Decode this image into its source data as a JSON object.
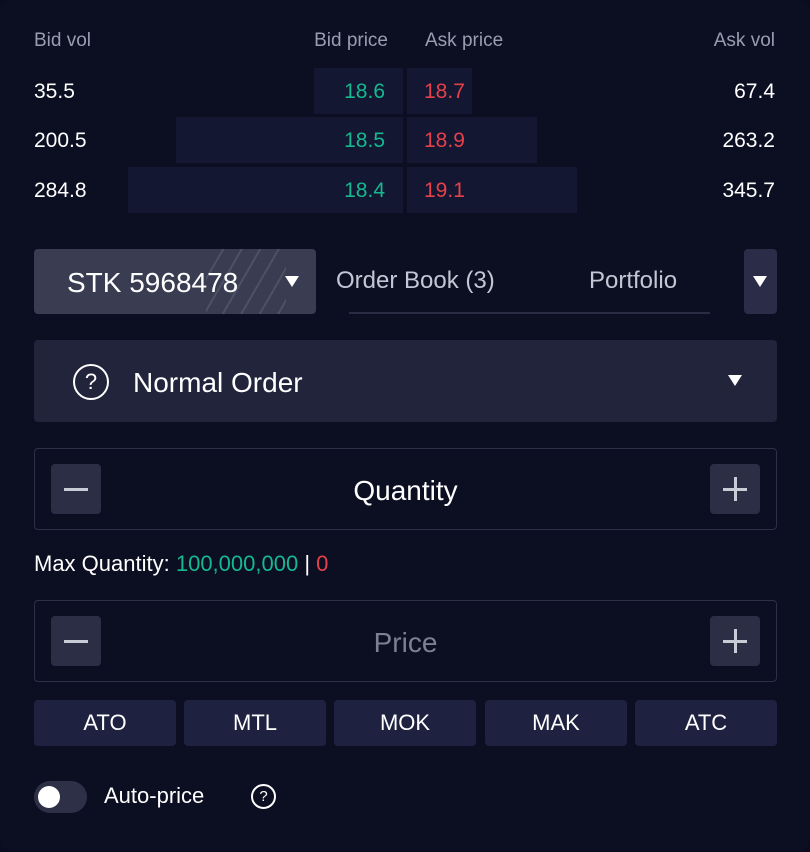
{
  "order_book": {
    "headers": {
      "bid_vol": "Bid vol",
      "bid_price": "Bid price",
      "ask_price": "Ask price",
      "ask_vol": "Ask vol"
    },
    "rows": [
      {
        "bid_vol": "35.5",
        "bid_price": "18.6",
        "ask_price": "18.7",
        "ask_vol": "67.4",
        "bid_depth": 0.11,
        "ask_depth": 0.08
      },
      {
        "bid_vol": "200.5",
        "bid_price": "18.5",
        "ask_price": "18.9",
        "ask_vol": "263.2",
        "bid_depth": 0.28,
        "ask_depth": 0.16
      },
      {
        "bid_vol": "284.8",
        "bid_price": "18.4",
        "ask_price": "19.1",
        "ask_vol": "345.7",
        "bid_depth": 0.34,
        "ask_depth": 0.21
      }
    ]
  },
  "symbol": {
    "label": "STK 5968478",
    "icon": "chevron-down-icon"
  },
  "tabs": [
    {
      "label": "Order Book (3)"
    },
    {
      "label": "Portfolio"
    }
  ],
  "order_type": {
    "label": "Normal Order",
    "help_icon": "?"
  },
  "quantity": {
    "placeholder": "Quantity",
    "minus_icon": "minus-icon",
    "plus_icon": "plus-icon"
  },
  "max_quantity": {
    "label": "Max Quantity:",
    "value": "100,000,000",
    "separator": "|",
    "value2": "0"
  },
  "price": {
    "placeholder": "Price",
    "minus_icon": "minus-icon",
    "plus_icon": "plus-icon"
  },
  "price_types": [
    "ATO",
    "MTL",
    "MOK",
    "MAK",
    "ATC"
  ],
  "auto_price": {
    "label": "Auto-price",
    "enabled": false,
    "help_icon": "?"
  },
  "colors": {
    "bid": "#16b890",
    "ask": "#e6404a",
    "background": "#0c0e22",
    "panel": "#22243c"
  }
}
